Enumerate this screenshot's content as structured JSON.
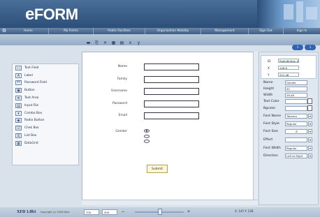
{
  "app": {
    "logo": "FORM",
    "logo_prefix": "e"
  },
  "navbar": {
    "items": [
      "Home",
      "My Forms",
      "Public Facilities",
      "Organization Mobility",
      "Management",
      "Sign Out",
      "Sign In"
    ]
  },
  "subbar": {
    "pills": [
      "1",
      "1"
    ]
  },
  "toolbar": {
    "icons": [
      "save-icon",
      "copy-icon",
      "delete-icon",
      "grid-icon",
      "align-icon",
      "x-icon",
      "y-icon"
    ],
    "glyphs": [
      "▬",
      "⎘",
      "✕",
      "▦",
      "▤",
      "x",
      "y"
    ]
  },
  "sidebar": {
    "items": [
      {
        "label": "Text Field",
        "icon": "text-field-icon",
        "glyph": "▭"
      },
      {
        "label": "Label",
        "icon": "label-icon",
        "glyph": "A"
      },
      {
        "label": "Password Field",
        "icon": "password-field-icon",
        "glyph": "**"
      },
      {
        "label": "Button",
        "icon": "button-icon",
        "glyph": "▣"
      },
      {
        "label": "Text Area",
        "icon": "text-area-icon",
        "glyph": "≣"
      },
      {
        "label": "Input File",
        "icon": "input-file-icon",
        "glyph": "▤"
      },
      {
        "label": "Combo Box",
        "icon": "combo-box-icon",
        "glyph": "▾"
      },
      {
        "label": "Radio Button",
        "icon": "radio-button-icon",
        "glyph": "◉"
      },
      {
        "label": "Chek Box",
        "icon": "check-box-icon",
        "glyph": "☑"
      },
      {
        "label": "List Box",
        "icon": "list-box-icon",
        "glyph": "☰"
      },
      {
        "label": "DataGrid",
        "icon": "datagrid-icon",
        "glyph": "▦"
      }
    ]
  },
  "form": {
    "fields": [
      {
        "label": "Name"
      },
      {
        "label": "Family"
      },
      {
        "label": "Username"
      },
      {
        "label": "Password"
      },
      {
        "label": "Email"
      }
    ],
    "gender_label": "Gender",
    "submit_label": "Submit"
  },
  "properties": {
    "id_label": "ID",
    "id_value": "RadioButton.H",
    "x_label": "X",
    "x_value": "146.8",
    "y_label": "Y",
    "y_value": "201.48",
    "rows": [
      {
        "label": "Name",
        "value": "Gender",
        "type": "text"
      },
      {
        "label": "Height",
        "value": "50",
        "type": "text"
      },
      {
        "label": "Width",
        "value": "26.48",
        "type": "text"
      },
      {
        "label": "Text Color",
        "value": "",
        "type": "swatch"
      },
      {
        "label": "Bgcolor",
        "value": "",
        "type": "swatch"
      },
      {
        "label": "Font Name",
        "value": "Tahoma",
        "type": "select"
      },
      {
        "label": "Font Style",
        "value": "Regular",
        "type": "select"
      },
      {
        "label": "Font Size",
        "value": "8",
        "type": "select"
      },
      {
        "label": "Effect",
        "value": "",
        "type": "select"
      },
      {
        "label": "Font Width",
        "value": "Regular",
        "type": "select"
      },
      {
        "label": "Direction",
        "value": "Left to Right",
        "type": "select"
      }
    ]
  },
  "status": {
    "title": "XFD 1.0b1",
    "copyright": "Copyright (c) 2008 Xtec",
    "width_value": "700",
    "height_value": "500",
    "coords": "X: 145  Y: 228"
  }
}
